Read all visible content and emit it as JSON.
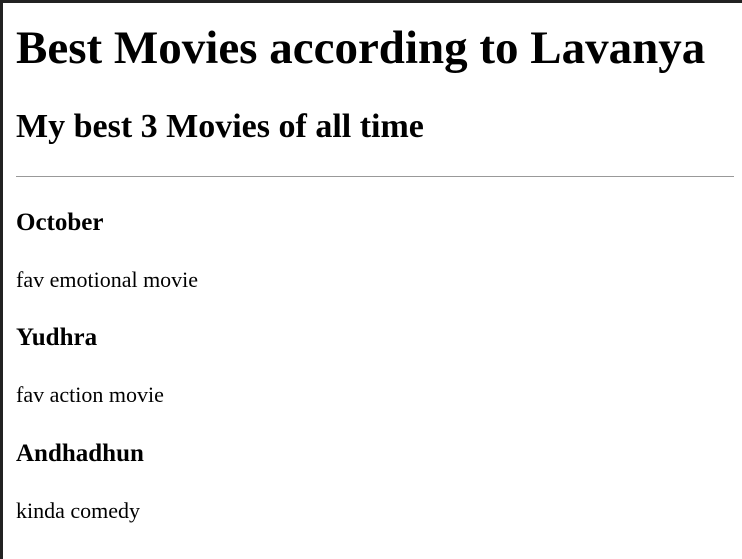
{
  "page": {
    "title": "Best Movies according to Lavanya",
    "subtitle": "My best 3 Movies of all time"
  },
  "movies": [
    {
      "title": "October",
      "description": "fav emotional movie"
    },
    {
      "title": "Yudhra",
      "description": "fav action movie"
    },
    {
      "title": "Andhadhun",
      "description": "kinda comedy"
    }
  ],
  "colors": {
    "text": "#000000",
    "background": "#ffffff",
    "divider": "#999999",
    "frame_border": "#222222"
  }
}
